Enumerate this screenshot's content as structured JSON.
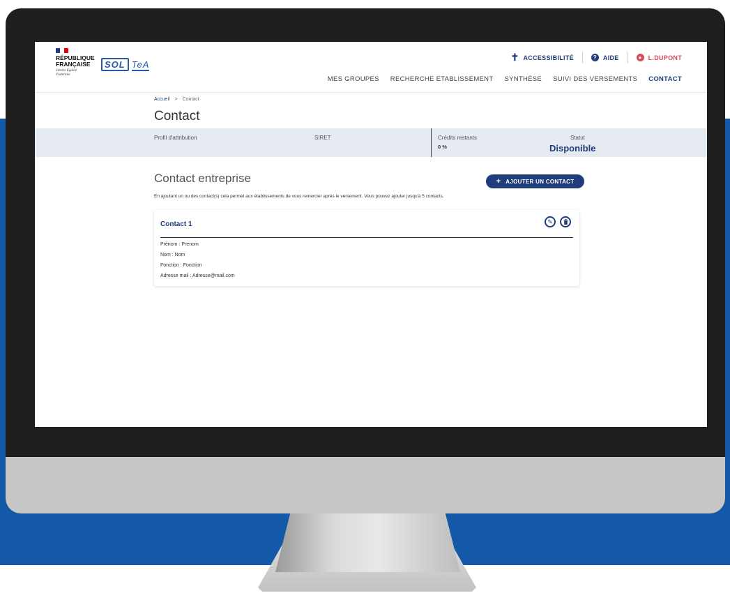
{
  "header": {
    "gov_name": "RÉPUBLIQUE FRANÇAISE",
    "gov_motto": "Liberté Égalité Fraternité",
    "brand": {
      "sol": "SOL",
      "tea": "TeA"
    },
    "top_links": {
      "accessibility": "ACCESSIBILITÉ",
      "help": "AIDE",
      "user": "L.DUPONT"
    },
    "nav": [
      "MES GROUPES",
      "RECHERCHE ETABLISSEMENT",
      "SYNTHÈSE",
      "SUIVI DES VERSEMENTS",
      "CONTACT"
    ],
    "active_nav": "CONTACT"
  },
  "breadcrumb": {
    "home": "Accueil",
    "separator": ">",
    "current": "Contact"
  },
  "page_title": "Contact",
  "info_band": {
    "profile_label": "Profil d'attribution",
    "siret_label": "SIRET",
    "credits_label": "Crédits restants",
    "credits_value": "0 %",
    "status_label": "Statut",
    "status_value": "Disponible"
  },
  "section": {
    "title": "Contact entreprise",
    "add_button": "AJOUTER UN CONTACT",
    "description": "En ajoutant un ou des contact(s) cela permet aux établissements de vous remercier après le versement. Vous pouvez ajouter jusqu'à 5 contacts."
  },
  "contacts": [
    {
      "title": "Contact 1",
      "firstname": "Prénom : Prenom",
      "lastname": "Nom : Nom",
      "function": "Fonction : Fonction",
      "email": "Adresse mail : Adresse@mail.com"
    }
  ],
  "colors": {
    "brand_blue": "#1f3d7a",
    "band_blue": "#1459a8",
    "user_red": "#d84a5a",
    "info_band": "#e6ebf2"
  },
  "icons": [
    "accessibility-icon",
    "help-icon",
    "user-icon",
    "plus-icon",
    "edit-icon",
    "delete-icon"
  ]
}
